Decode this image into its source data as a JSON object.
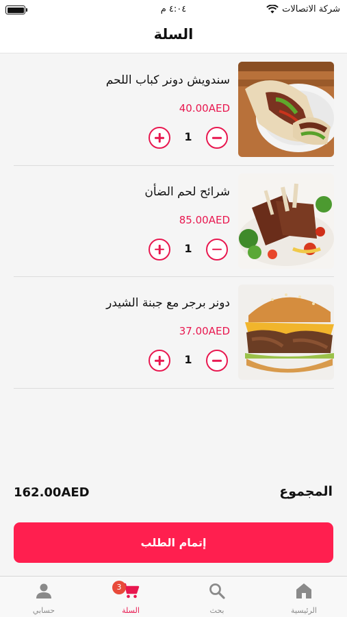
{
  "status_bar": {
    "carrier": "شركة الاتصالات",
    "time": "٤:٠٤ م"
  },
  "header": {
    "title": "السلة"
  },
  "cart": {
    "items": [
      {
        "name": "سندويش دونر كباب اللحم",
        "price": "40.00AED",
        "quantity": "1",
        "image": "doner-wrap"
      },
      {
        "name": "شرائح لحم الضأن",
        "price": "85.00AED",
        "quantity": "1",
        "image": "lamb-chops"
      },
      {
        "name": "دونر برجر مع جبنة الشيدر",
        "price": "37.00AED",
        "quantity": "1",
        "image": "doner-burger"
      }
    ]
  },
  "summary": {
    "total_label": "المجموع",
    "total_value": "162.00AED"
  },
  "checkout": {
    "label": "إتمام الطلب"
  },
  "tabbar": {
    "tabs": [
      {
        "label": "الرئيسية",
        "icon": "home-icon"
      },
      {
        "label": "بحث",
        "icon": "search-icon"
      },
      {
        "label": "السلة",
        "icon": "cart-icon",
        "badge": "3",
        "active": true
      },
      {
        "label": "حسابي",
        "icon": "person-icon"
      }
    ]
  },
  "colors": {
    "accent": "#e8174f",
    "checkout_button": "#ff1f4f",
    "badge": "#e84a3a",
    "inactive_tab": "#8a8a8a"
  }
}
